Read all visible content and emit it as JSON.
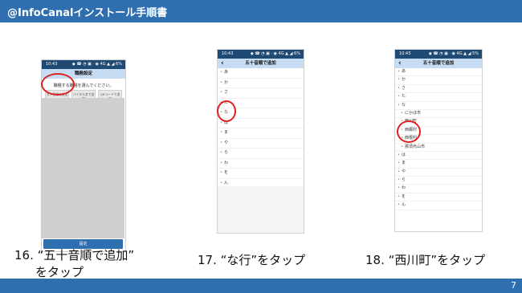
{
  "header": {
    "title": "@InfoCanalインストール手順書"
  },
  "page_number": "7",
  "phones": {
    "p1": {
      "status_time": "10:43",
      "status_icons": "◆ ☎ ◔ ▣ · ◉ 4G ▲ ◢ 6%",
      "title": "職務設定",
      "instruction": "職種する職種を選んでください。",
      "buttons": [
        "五十音順で追加",
        "バイタル名で追加",
        "QRコードで追加"
      ],
      "set_button": "設定"
    },
    "p2": {
      "status_time": "10:43",
      "status_icons": "◆ ☎ ◔ ▣ · ◉ 4G ▲ ◢ 6%",
      "title": "五十音順で追加",
      "rows": [
        "あ",
        "か",
        "さ",
        "た",
        "な",
        "は",
        "ま",
        "や",
        "ら",
        "わ",
        "を",
        "ん"
      ]
    },
    "p3": {
      "status_time": "10:43",
      "status_icons": "◆ ☎ ◔ ▣ · ◉ 4G ▲ ◢ 5%",
      "title": "五十音順で追加",
      "rows": [
        "あ",
        "か",
        "さ",
        "た",
        "な"
      ],
      "sub_rows": [
        "にかほ市",
        "西川町",
        "西郷村",
        "西根村",
        "那須烏山市"
      ],
      "rows_after": [
        "は",
        "ま",
        "や",
        "ら",
        "わ",
        "を",
        "ん"
      ]
    }
  },
  "captions": {
    "c1_line1": "16. “五十音順で追加”",
    "c1_line2": "をタップ",
    "c2": "17. “な行”をタップ",
    "c3": "18. “西川町”をタップ"
  }
}
